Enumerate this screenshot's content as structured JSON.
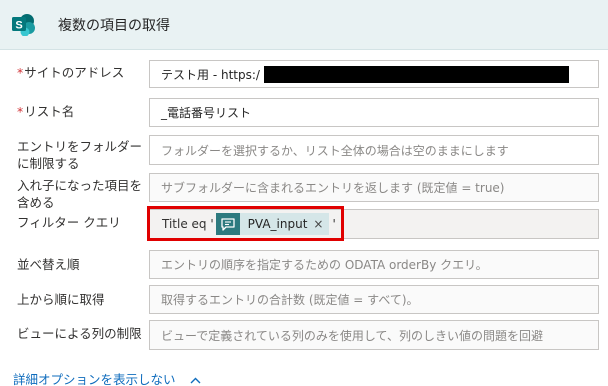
{
  "header": {
    "title": "複数の項目の取得",
    "icon": "sharepoint-icon",
    "icon_color": "#036c70"
  },
  "fields": {
    "site_address": {
      "label": "サイトのアドレス",
      "required": "*",
      "value": "テスト用 - https:/"
    },
    "list_name": {
      "label": "リスト名",
      "required": "*",
      "value": "_電話番号リスト"
    },
    "folder_limit": {
      "label_line1": "エントリをフォルダー",
      "label_line2": "に制限する",
      "placeholder": "フォルダーを選択するか、リスト全体の場合は空のままにします"
    },
    "nested": {
      "label_line1": "入れ子になった項目を",
      "label_line2": "含める",
      "placeholder": "サブフォルダーに含まれるエントリを返します (既定値 = true)"
    },
    "filter_query": {
      "label": "フィルター クエリ",
      "prefix": "Title eq '",
      "token_label": "PVA_input",
      "token_close": "×",
      "suffix": "'"
    },
    "order_by": {
      "label": "並べ替え順",
      "placeholder": "エントリの順序を指定するための ODATA orderBy クエリ。"
    },
    "top_count": {
      "label": "上から順に取得",
      "placeholder": "取得するエントリの合計数 (既定値 = すべて)。"
    },
    "view_limit": {
      "label": "ビューによる列の制限",
      "placeholder": "ビューで定義されている列のみを使用して、列のしきい値の問題を回避"
    }
  },
  "advanced": {
    "label": "詳細オプションを表示しない",
    "chevron": "^"
  },
  "colors": {
    "header_bg": "#e9f2f3",
    "required": "#d13438",
    "token": "#2d7a7f",
    "highlight": "#e00000",
    "link": "#0f6cbd"
  }
}
